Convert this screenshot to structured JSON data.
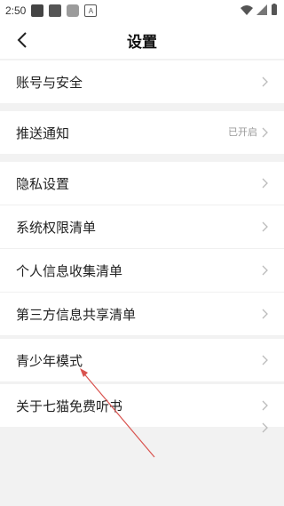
{
  "status_bar": {
    "time": "2:50",
    "icons": [
      "image-icon",
      "square-icon",
      "grey-icon",
      "a-icon"
    ],
    "right_icons": [
      "wifi-icon",
      "signal-icon",
      "battery-icon"
    ]
  },
  "header": {
    "title": "设置",
    "back_icon": "back-arrow-icon"
  },
  "sections": [
    {
      "items": [
        {
          "label": "账号与安全"
        }
      ]
    },
    {
      "items": [
        {
          "label": "推送通知",
          "status": "已开启"
        }
      ]
    },
    {
      "items": [
        {
          "label": "隐私设置"
        },
        {
          "label": "系统权限清单"
        },
        {
          "label": "个人信息收集清单"
        },
        {
          "label": "第三方信息共享清单"
        },
        {
          "label": "青少年模式"
        },
        {
          "label": "关于七猫免费听书"
        }
      ]
    }
  ],
  "annotation": {
    "type": "red-arrow",
    "color": "#d9534f",
    "target": "青少年模式"
  }
}
